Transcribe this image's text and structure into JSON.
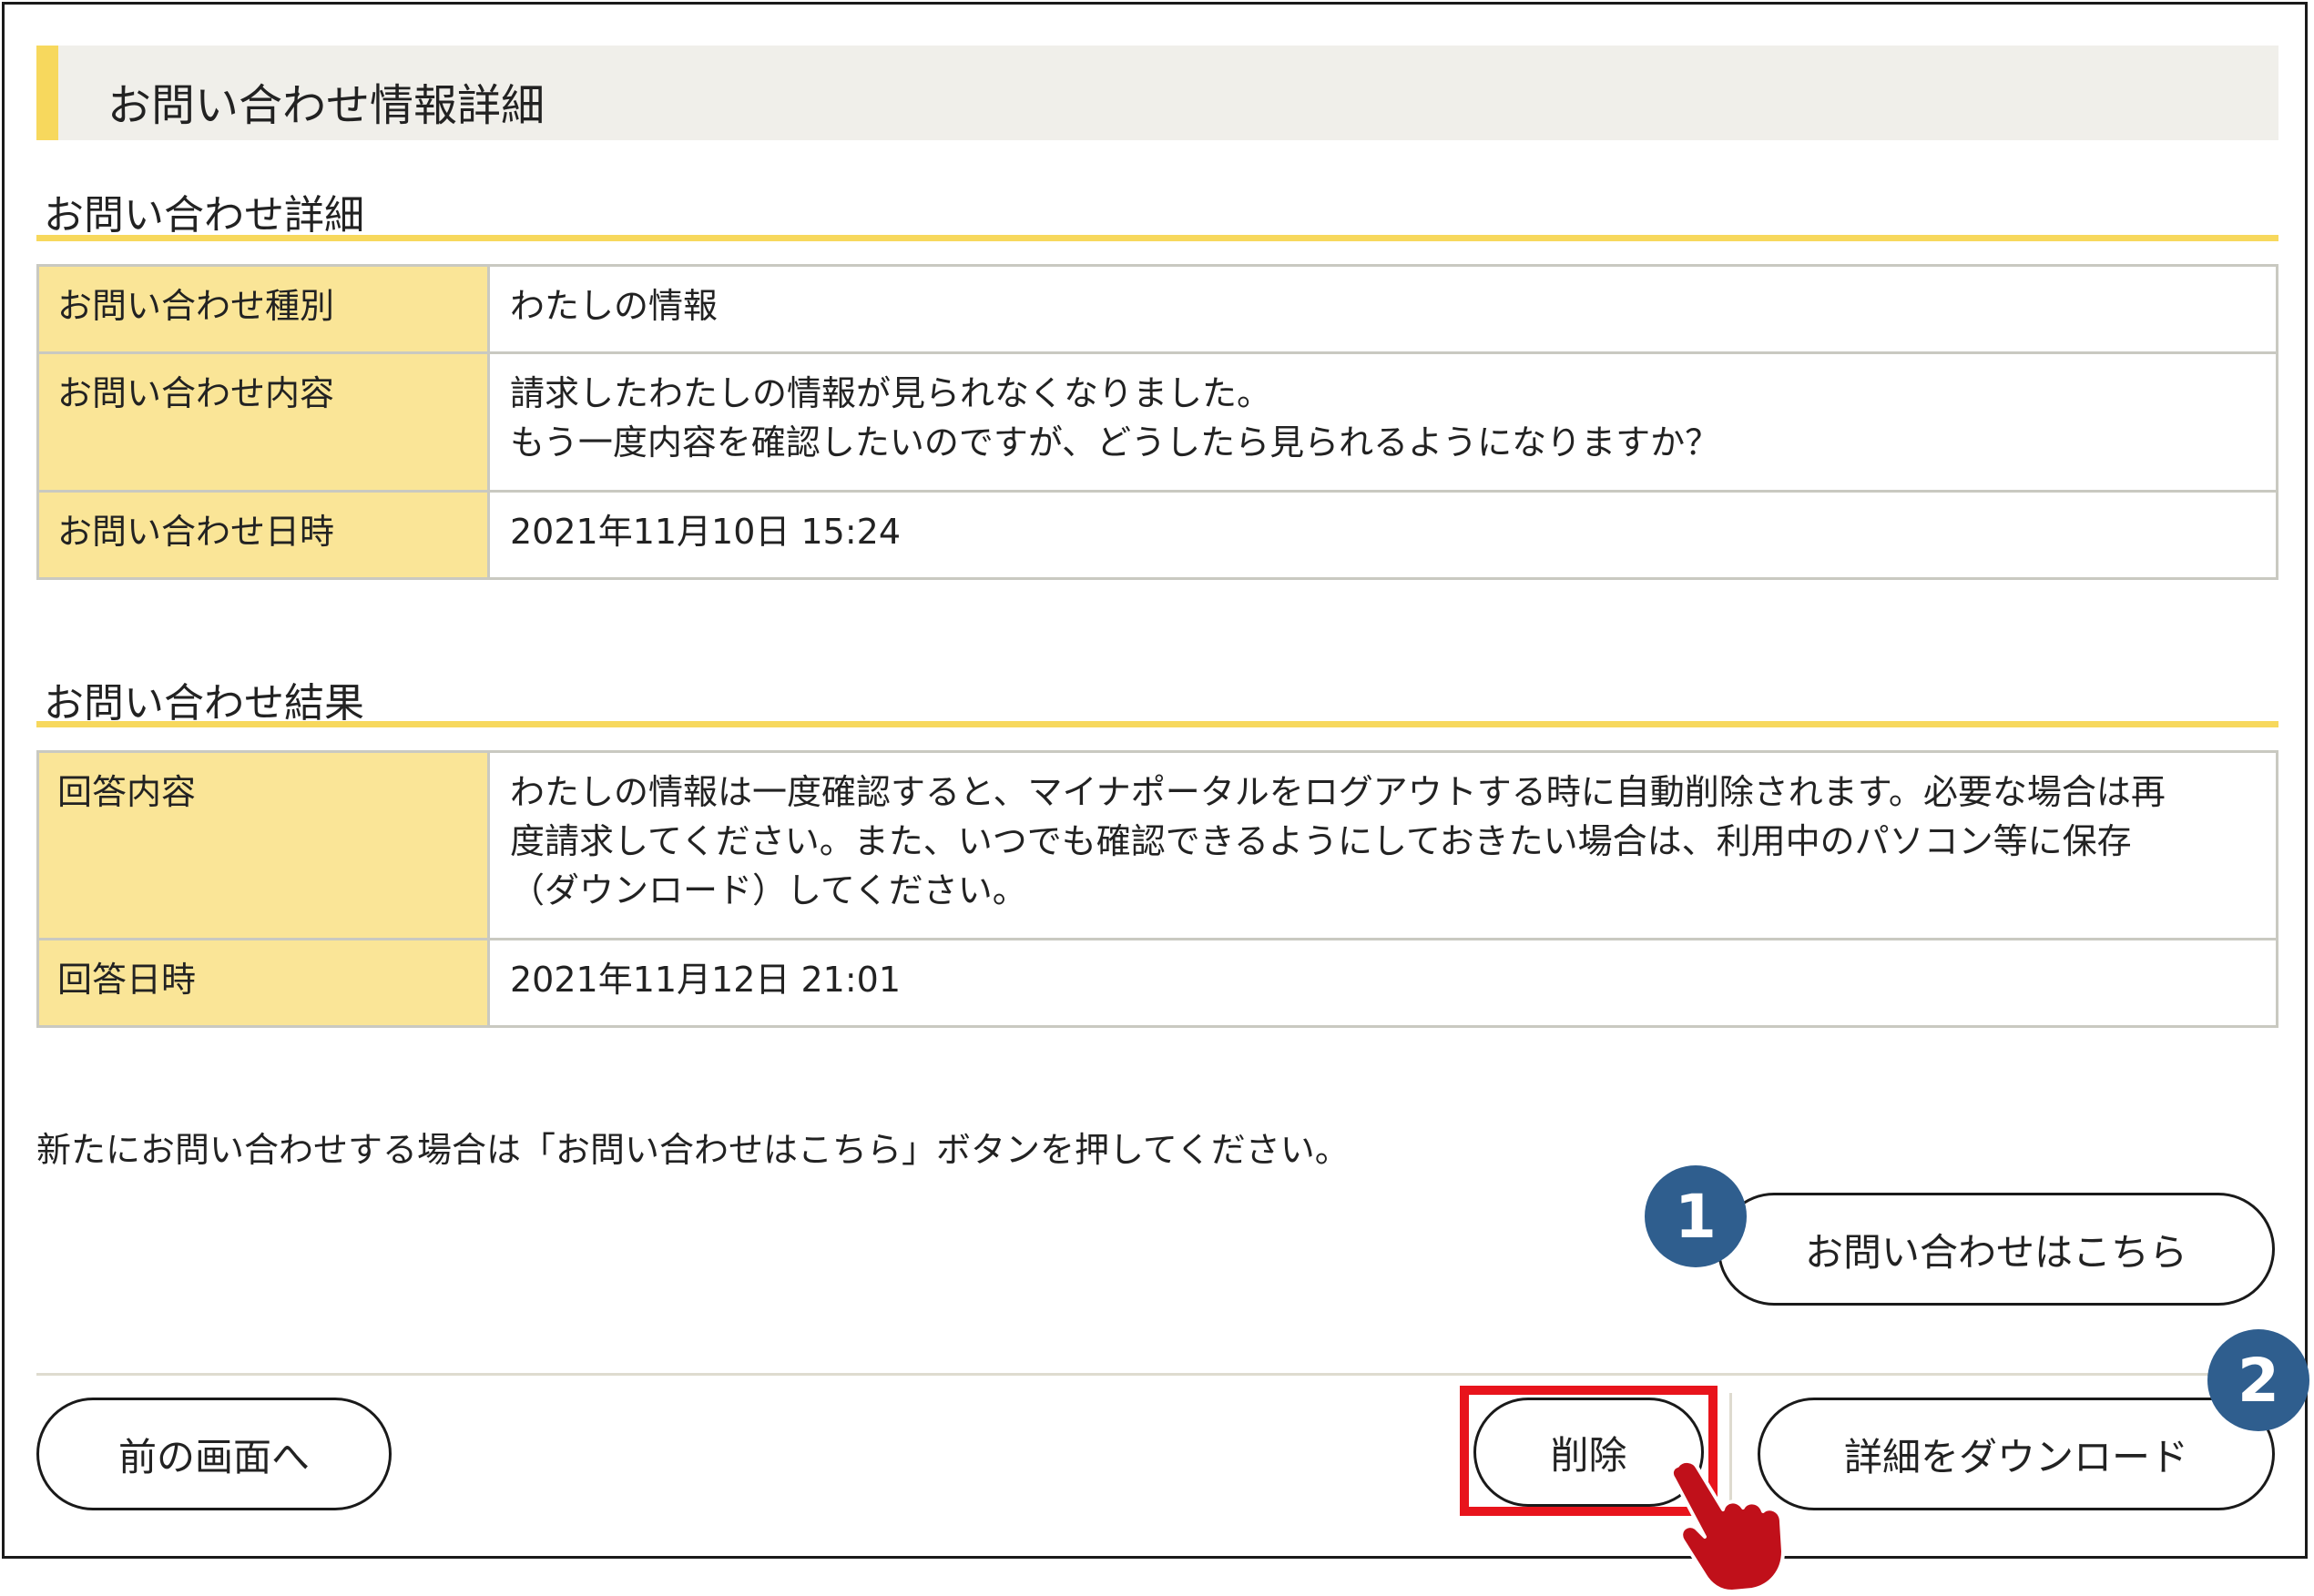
{
  "header": {
    "title": "お問い合わせ情報詳細"
  },
  "inquiry_details": {
    "heading": "お問い合わせ詳細",
    "rows": [
      {
        "label": "お問い合わせ種別",
        "value": "わたしの情報"
      },
      {
        "label": "お問い合わせ内容",
        "value": "請求したわたしの情報が見られなくなりました。\nもう一度内容を確認したいのですが、どうしたら見られるようになりますか？"
      },
      {
        "label": "お問い合わせ日時",
        "value": "2021年11月10日 15:24"
      }
    ]
  },
  "inquiry_result": {
    "heading": "お問い合わせ結果",
    "rows": [
      {
        "label": "回答内容",
        "value": "わたしの情報は一度確認すると、マイナポータルをログアウトする時に自動削除されます。必要な場合は再\n度請求してください。また、いつでも確認できるようにしておきたい場合は、利用中のパソコン等に保存\n（ダウンロード）してください。"
      },
      {
        "label": "回答日時",
        "value": "2021年11月12日 21:01"
      }
    ]
  },
  "note": "新たにお問い合わせする場合は「お問い合わせはこちら」ボタンを押してください。",
  "buttons": {
    "new_inquiry": "お問い合わせはこちら",
    "back": "前の画面へ",
    "delete": "削除",
    "download": "詳細をダウンロード"
  },
  "badges": {
    "first": "1",
    "second": "2"
  },
  "colors": {
    "accent_yellow": "#f7d85d",
    "label_bg": "#fae597",
    "badge_blue": "#2f5e8e",
    "highlight_red": "#e8141c"
  },
  "icons": {
    "pointer": "hand-pointer-icon"
  }
}
